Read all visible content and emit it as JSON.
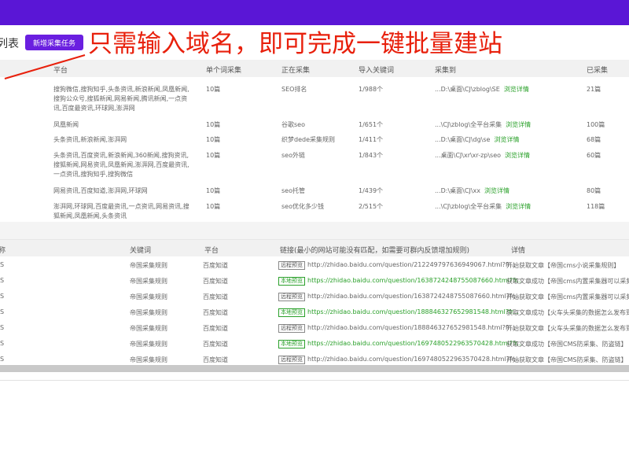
{
  "header": {
    "title": "列表",
    "new_task_button": "新增采集任务"
  },
  "annotation": "只需输入域名，即可完成一键批量建站",
  "task_table": {
    "columns": [
      "平台",
      "单个词采集",
      "正在采集",
      "导入关键词",
      "采集到",
      "已采集"
    ],
    "rows": [
      {
        "platform": "搜狗微信,搜狗知乎,头条资讯,新浪新闻,凤凰新闻,搜狗公众号,搜狐新闻,网易新闻,腾讯新闻,一点资讯,百度最资讯,环球网,澎湃网",
        "per_word": "10篇",
        "collecting": "SEO排名",
        "imported": "1/988个",
        "target": "...D:\\桌面\\CJ\\zblog\\SE",
        "link": "浏览详情",
        "done": "21篇"
      },
      {
        "platform": "凤凰新闻",
        "per_word": "10篇",
        "collecting": "谷歌seo",
        "imported": "1/651个",
        "target": "...\\CJ\\zblog\\全平台采集",
        "link": "浏览详情",
        "done": "100篇"
      },
      {
        "platform": "头条资讯,新浪新闻,澎湃网",
        "per_word": "10篇",
        "collecting": "织梦dede采集规则",
        "imported": "1/411个",
        "target": "...D:\\桌面\\CJ\\dg\\se",
        "link": "浏览详情",
        "done": "68篇"
      },
      {
        "platform": "头条资讯,百度资讯,新浪新闻,360新闻,搜狗资讯,搜狐新闻,网易资讯,凤凰新闻,澎湃网,百度最资讯,一点资讯,搜狗知乎,搜狗微信",
        "per_word": "10篇",
        "collecting": "seo外链",
        "imported": "1/843个",
        "target": "...桌面\\CJ\\xr\\xr-zp\\seo",
        "link": "浏览详情",
        "done": "60篇"
      },
      {
        "platform": "网易资讯,百度知道,澎湃网,环球网",
        "per_word": "10篇",
        "collecting": "seo托管",
        "imported": "1/439个",
        "target": "...D:\\桌面\\CJ\\xx",
        "link": "浏览详情",
        "done": "80篇"
      },
      {
        "platform": "澎湃网,环球网,百度最资讯,一点资讯,网易资讯,搜狐新闻,凤凰新闻,头条资讯",
        "per_word": "10篇",
        "collecting": "seo优化多少钱",
        "imported": "2/515个",
        "target": "...\\CJ\\zblog\\全平台采集",
        "link": "浏览详情",
        "done": "118篇"
      }
    ]
  },
  "log_table": {
    "columns": [
      "称",
      "关键词",
      "平台",
      "链接(最小的网站可能没有匹配，如需要可群内反馈增加规则)",
      "详情"
    ],
    "rows": [
      {
        "name": "S",
        "keyword": "帝国采集规则",
        "platform": "百度知道",
        "badge": "远程预览",
        "badge_green": false,
        "url": "http://zhidao.baidu.com/question/212249797636949067.html?fr...",
        "url_green": false,
        "detail": "开始获取文章【帝国cms小说采集规则】"
      },
      {
        "name": "S",
        "keyword": "帝国采集规则",
        "platform": "百度知道",
        "badge": "本地预览",
        "badge_green": true,
        "url": "https://zhidao.baidu.com/question/1638724248755087660.html?fr...",
        "url_green": true,
        "detail": "获取文章成功【帝国cms内置采集器可以采集】"
      },
      {
        "name": "S",
        "keyword": "帝国采集规则",
        "platform": "百度知道",
        "badge": "远程预览",
        "badge_green": false,
        "url": "http://zhidao.baidu.com/question/1638724248755087660.html?fr...",
        "url_green": false,
        "detail": "开始获取文章【帝国cms内置采集器可以采集】"
      },
      {
        "name": "S",
        "keyword": "帝国采集规则",
        "platform": "百度知道",
        "badge": "本地预览",
        "badge_green": true,
        "url": "https://zhidao.baidu.com/question/188846327652981548.html?fr...",
        "url_green": true,
        "detail": "获取文章成功【火车头采集的数据怎么发布到】"
      },
      {
        "name": "S",
        "keyword": "帝国采集规则",
        "platform": "百度知道",
        "badge": "远程预览",
        "badge_green": false,
        "url": "http://zhidao.baidu.com/question/188846327652981548.html?fr...",
        "url_green": false,
        "detail": "开始获取文章【火车头采集的数据怎么发布到】"
      },
      {
        "name": "S",
        "keyword": "帝国采集规则",
        "platform": "百度知道",
        "badge": "本地预览",
        "badge_green": true,
        "url": "https://zhidao.baidu.com/question/1697480522963570428.html?fr...",
        "url_green": true,
        "detail": "获取文章成功【帝国CMS防采集、防盗链】"
      },
      {
        "name": "S",
        "keyword": "帝国采集规则",
        "platform": "百度知道",
        "badge": "远程预览",
        "badge_green": false,
        "url": "http://zhidao.baidu.com/question/1697480522963570428.html?fr...",
        "url_green": false,
        "detail": "开始获取文章【帝国CMS防采集、防盗链】"
      }
    ]
  },
  "colors": {
    "topbar": "#5a16d6",
    "primary_button": "#6a1fe0",
    "annotation": "#e8200c",
    "link_green": "#2aa02a"
  }
}
